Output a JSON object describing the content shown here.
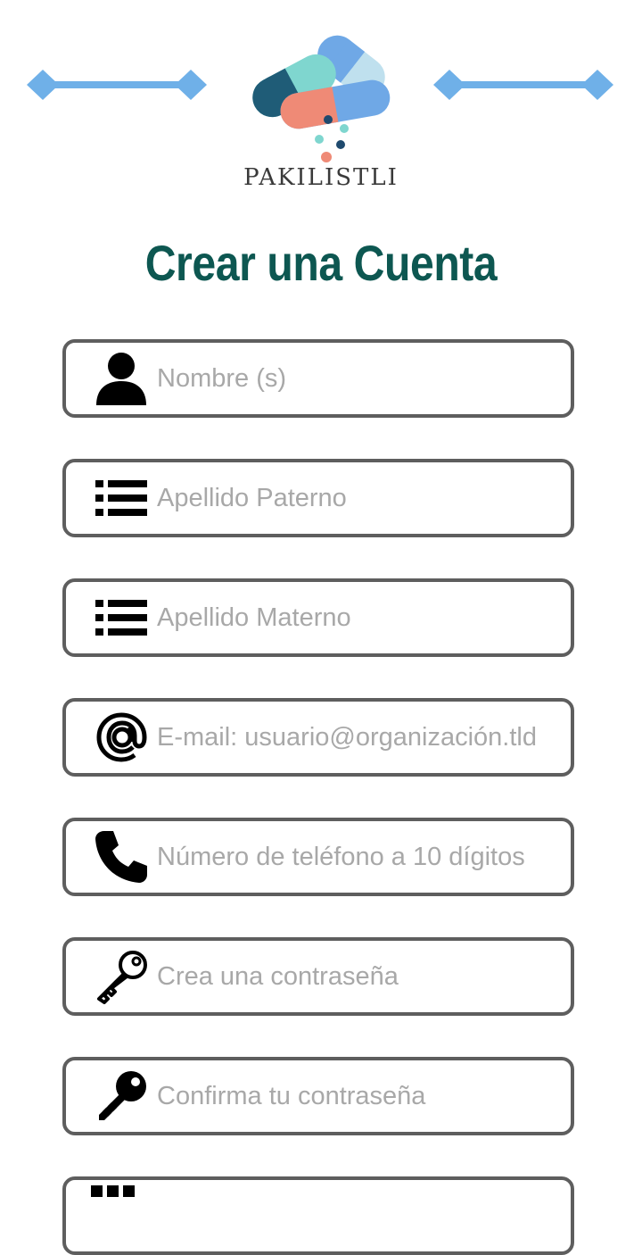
{
  "brand": {
    "name": "PAKILISTLI"
  },
  "page": {
    "title": "Crear una Cuenta"
  },
  "colors": {
    "title": "#0d5751",
    "border": "#5e5e5e",
    "placeholder": "#a8a8a8",
    "deco": "#6fb0e8"
  },
  "form": {
    "fields": [
      {
        "icon": "person-icon",
        "placeholder": "Nombre (s)",
        "value": ""
      },
      {
        "icon": "list-icon",
        "placeholder": "Apellido Paterno",
        "value": ""
      },
      {
        "icon": "list-icon",
        "placeholder": "Apellido Materno",
        "value": ""
      },
      {
        "icon": "at-sign-icon",
        "placeholder": "E-mail: usuario@organización.tld",
        "value": ""
      },
      {
        "icon": "phone-icon",
        "placeholder": "Número de teléfono a 10 dígitos",
        "value": ""
      },
      {
        "icon": "key-outline-icon",
        "placeholder": "Crea una contraseña",
        "value": ""
      },
      {
        "icon": "key-filled-icon",
        "placeholder": "Confirma tu contraseña",
        "value": ""
      },
      {
        "icon": "dots-icon",
        "placeholder": "",
        "value": ""
      }
    ]
  }
}
